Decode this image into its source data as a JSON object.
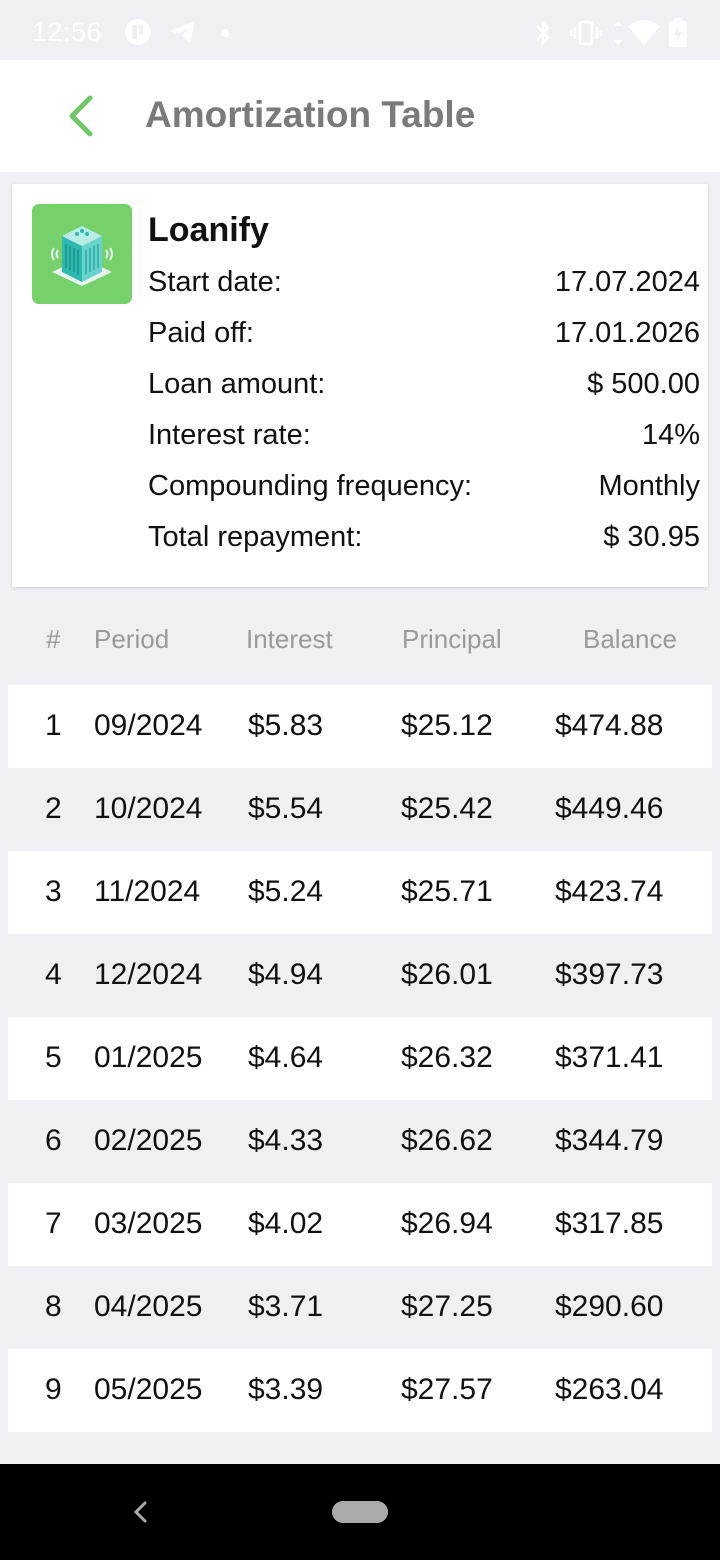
{
  "status_bar": {
    "time": "12:56"
  },
  "header": {
    "title": "Amortization Table"
  },
  "summary": {
    "brand": "Loanify",
    "rows": [
      {
        "label": "Start date:",
        "value": "17.07.2024"
      },
      {
        "label": "Paid off:",
        "value": "17.01.2026"
      },
      {
        "label": "Loan amount:",
        "value": "$ 500.00"
      },
      {
        "label": "Interest rate:",
        "value": "14%"
      },
      {
        "label": "Compounding frequency:",
        "value": "Monthly"
      },
      {
        "label": "Total repayment:",
        "value": "$ 30.95"
      }
    ]
  },
  "table": {
    "headers": [
      "#",
      "Period",
      "Interest",
      "Principal",
      "Balance"
    ],
    "rows": [
      [
        "1",
        "09/2024",
        "$5.83",
        "$25.12",
        "$474.88"
      ],
      [
        "2",
        "10/2024",
        "$5.54",
        "$25.42",
        "$449.46"
      ],
      [
        "3",
        "11/2024",
        "$5.24",
        "$25.71",
        "$423.74"
      ],
      [
        "4",
        "12/2024",
        "$4.94",
        "$26.01",
        "$397.73"
      ],
      [
        "5",
        "01/2025",
        "$4.64",
        "$26.32",
        "$371.41"
      ],
      [
        "6",
        "02/2025",
        "$4.33",
        "$26.62",
        "$344.79"
      ],
      [
        "7",
        "03/2025",
        "$4.02",
        "$26.94",
        "$317.85"
      ],
      [
        "8",
        "04/2025",
        "$3.71",
        "$27.25",
        "$290.60"
      ],
      [
        "9",
        "05/2025",
        "$3.39",
        "$27.57",
        "$263.04"
      ]
    ]
  },
  "colors": {
    "accent": "#76d16b",
    "back_arrow": "#6cc964",
    "title": "#7a7a7a",
    "background": "#eff0f4"
  },
  "icons": [
    "back-arrow-icon",
    "loanify-logo-icon",
    "bluetooth-icon",
    "vibrate-icon",
    "wifi-icon",
    "battery-icon",
    "telegram-icon"
  ]
}
